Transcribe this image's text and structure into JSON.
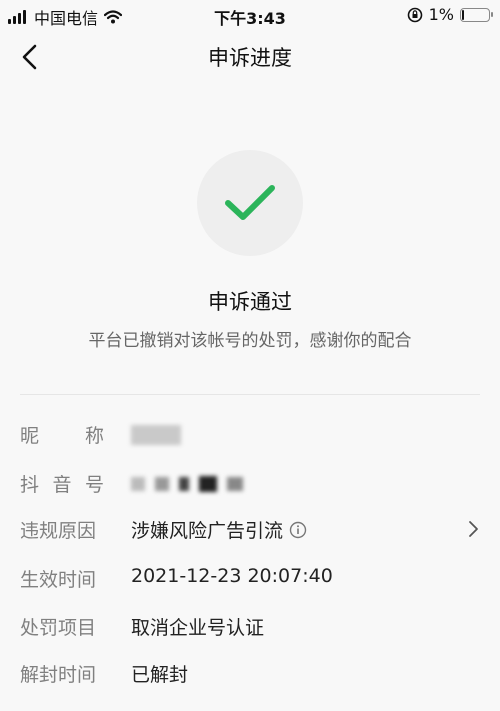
{
  "status_bar": {
    "carrier": "中国电信",
    "time": "下午3:43",
    "battery": "1%",
    "battery_level": 0.05
  },
  "nav": {
    "title": "申诉进度",
    "back_icon": "chevron-left-icon"
  },
  "result": {
    "icon": "check-icon",
    "accent_color": "#2bb45a",
    "title": "申诉通过",
    "description": "平台已撤销对该帐号的处罚，感谢你的配合"
  },
  "details": {
    "nickname_label_a": "昵",
    "nickname_label_b": "称",
    "douyin_label_a": "抖",
    "douyin_label_b": "音",
    "douyin_label_c": "号",
    "reason_label": "违规原因",
    "reason_value": "涉嫌风险广告引流",
    "effective_label": "生效时间",
    "effective_value": "2021-12-23 20:07:40",
    "penalty_label": "处罚项目",
    "penalty_value": "取消企业号认证",
    "unblock_label": "解封时间",
    "unblock_value": "已解封"
  }
}
